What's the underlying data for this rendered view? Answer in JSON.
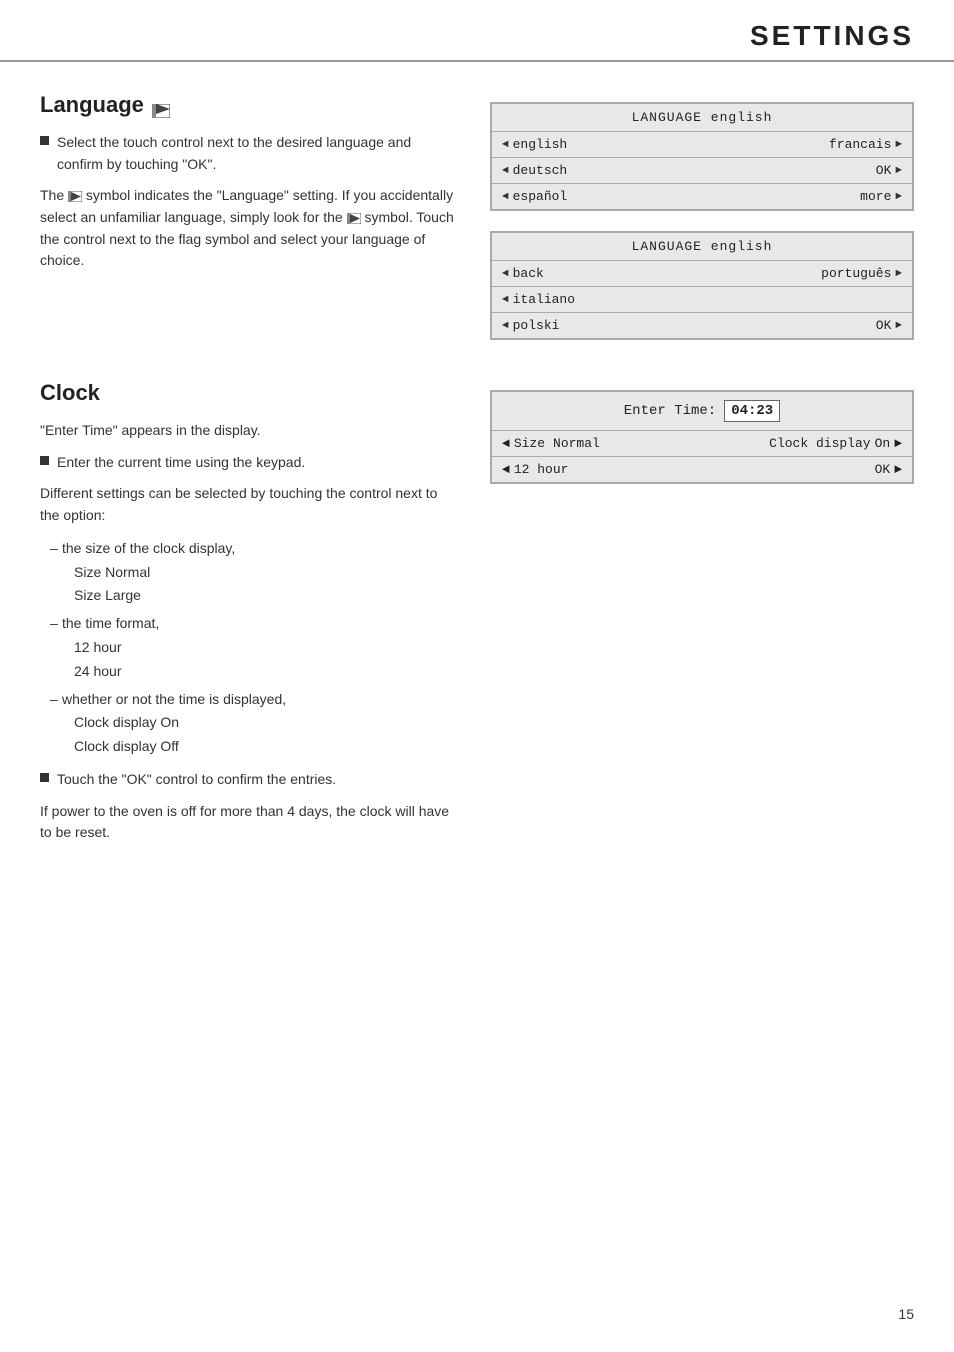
{
  "header": {
    "title": "SETTINGS"
  },
  "language_section": {
    "title": "Language",
    "bullet1": "Select the touch control next to the desired language and confirm by touching \"OK\".",
    "para1": "The",
    "para1_mid": "symbol indicates the \"Language\" setting. If you accidentally select an unfamiliar language, simply look for the",
    "para1_mid2": "symbol. Touch the control next to the flag symbol and select your language of choice.",
    "panel1": {
      "header": "LANGUAGE english",
      "rows": [
        {
          "left": "english",
          "right": "francais"
        },
        {
          "left": "deutsch",
          "right": "OK"
        },
        {
          "left": "español",
          "right": "more"
        }
      ]
    },
    "panel2": {
      "header": "LANGUAGE english",
      "rows": [
        {
          "left": "back",
          "right": "português"
        },
        {
          "left": "italiano",
          "right": ""
        },
        {
          "left": "polski",
          "right": "OK"
        }
      ]
    }
  },
  "clock_section": {
    "title": "Clock",
    "intro": "\"Enter Time\" appears in the display.",
    "bullet1": "Enter the current time using the keypad.",
    "para1": "Different settings can be selected by touching the control next to the option:",
    "dash_items": [
      {
        "label": "the size of the clock display,",
        "subitems": [
          "Size Normal",
          "Size Large"
        ]
      },
      {
        "label": "the time format,",
        "subitems": [
          "12 hour",
          "24 hour"
        ]
      },
      {
        "label": "whether or not the time is displayed,",
        "subitems": [
          "Clock display On",
          "Clock display Off"
        ]
      }
    ],
    "bullet2": "Touch the \"OK\" control to confirm the entries.",
    "para2": "If power to the oven is off for more than 4 days, the clock will have to be reset.",
    "panel": {
      "enter_time_label": "Enter Time:",
      "time_value": "04:23",
      "row1_left_arrow": "◄",
      "row1_left_label": "Size",
      "row1_left_value": "Normal",
      "row1_right_label": "Clock display",
      "row1_right_value": "On",
      "row2_left_arrow": "◄",
      "row2_left_label": "12 hour",
      "row2_right_label": "OK"
    }
  },
  "page_number": "15"
}
